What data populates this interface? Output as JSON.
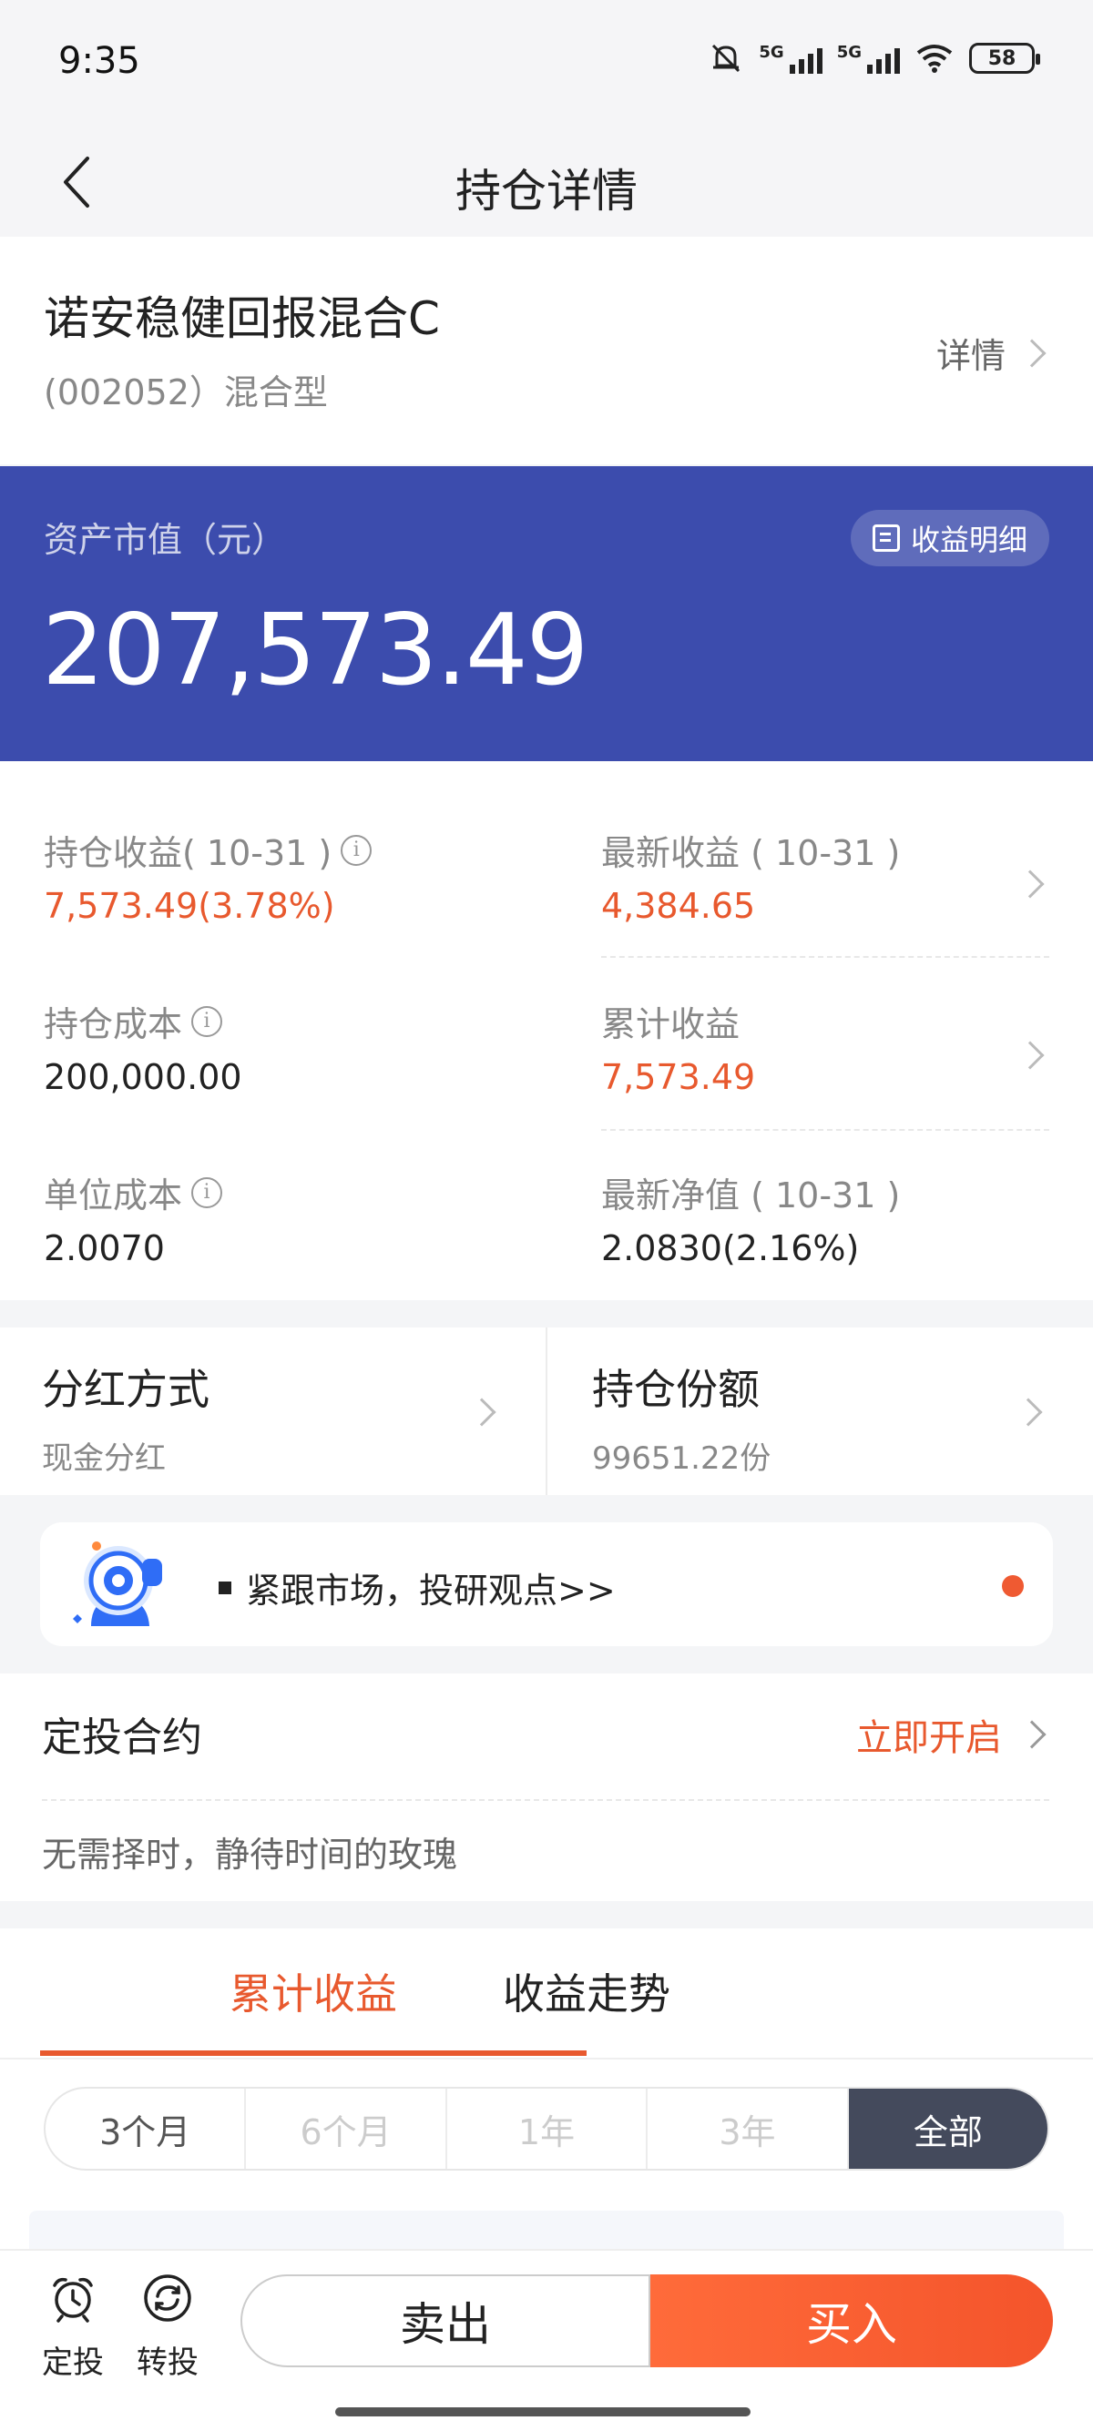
{
  "status_bar": {
    "time": "9:35",
    "network1": "5G",
    "network2": "5G",
    "battery": "58"
  },
  "nav": {
    "title": "持仓详情"
  },
  "fund": {
    "name": "诺安稳健回报混合C",
    "code_type": "(002052）混合型",
    "detail_label": "详情"
  },
  "asset": {
    "label": "资产市值（元）",
    "value": "207,573.49",
    "detail_button": "收益明细"
  },
  "stats": {
    "holding_profit_label": "持仓收益( 10-31 )",
    "holding_profit_value": "7,573.49(3.78%)",
    "latest_profit_label": "最新收益 ( 10-31 )",
    "latest_profit_value": "4,384.65",
    "holding_cost_label": "持仓成本",
    "holding_cost_value": "200,000.00",
    "cumulative_profit_label": "累计收益",
    "cumulative_profit_value": "7,573.49",
    "unit_cost_label": "单位成本",
    "unit_cost_value": "2.0070",
    "latest_nav_label": "最新净值 ( 10-31 )",
    "latest_nav_value": "2.0830(2.16%)"
  },
  "dividend": {
    "title": "分红方式",
    "value": "现金分红"
  },
  "shares": {
    "title": "持仓份额",
    "value": "99651.22份"
  },
  "promo": {
    "text": "紧跟市场，投研观点>>"
  },
  "sip": {
    "title": "定投合约",
    "action": "立即开启",
    "desc": "无需择时，静待时间的玫瑰"
  },
  "tabs": [
    {
      "label": "累计收益",
      "active": true
    },
    {
      "label": "收益走势",
      "active": false
    }
  ],
  "ranges": [
    "3个月",
    "6个月",
    "1年",
    "3年",
    "全部"
  ],
  "selected_range": "全部",
  "bottom_bar": {
    "sip_label": "定投",
    "switch_label": "转投",
    "sell_label": "卖出",
    "buy_label": "买入"
  },
  "colors": {
    "banner": "#3c4cad",
    "accent": "#e8592e",
    "selected_range_bg": "#444a5c"
  }
}
